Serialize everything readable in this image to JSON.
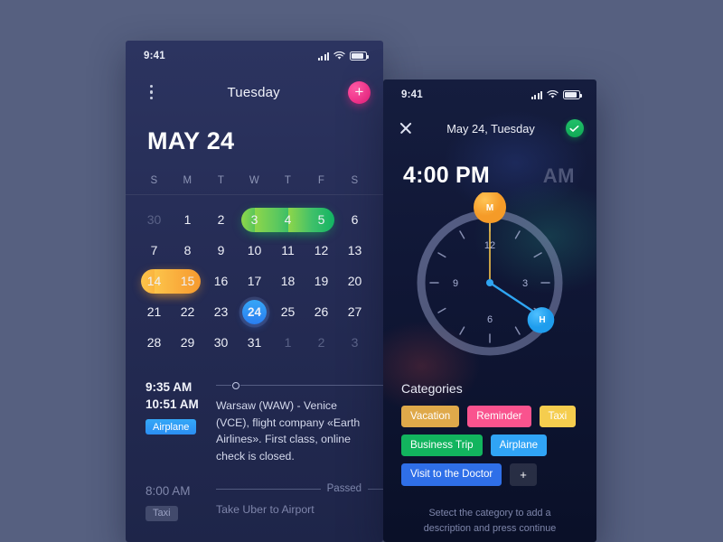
{
  "calendar_phone": {
    "status_bar": {
      "time": "9:41",
      "signal_icon": "signal-bars-icon",
      "wifi_icon": "wifi-icon",
      "battery_icon": "battery-icon"
    },
    "nav": {
      "menu_icon": "more-vertical-icon",
      "title": "Tuesday",
      "add_icon": "plus-icon"
    },
    "month_title": "MAY 24",
    "weekdays": [
      "S",
      "M",
      "T",
      "W",
      "T",
      "F",
      "S"
    ],
    "days": [
      {
        "label": "30",
        "type": "muted"
      },
      {
        "label": "1",
        "type": "normal"
      },
      {
        "label": "2",
        "type": "normal"
      },
      {
        "label": "3",
        "type": "range-green-start"
      },
      {
        "label": "4",
        "type": "range-green-mid"
      },
      {
        "label": "5",
        "type": "range-green-end"
      },
      {
        "label": "6",
        "type": "normal"
      },
      {
        "label": "7",
        "type": "normal"
      },
      {
        "label": "8",
        "type": "normal"
      },
      {
        "label": "9",
        "type": "normal"
      },
      {
        "label": "10",
        "type": "normal"
      },
      {
        "label": "11",
        "type": "normal"
      },
      {
        "label": "12",
        "type": "normal"
      },
      {
        "label": "13",
        "type": "normal"
      },
      {
        "label": "14",
        "type": "range-orange-start"
      },
      {
        "label": "15",
        "type": "range-orange-end"
      },
      {
        "label": "16",
        "type": "normal"
      },
      {
        "label": "17",
        "type": "normal"
      },
      {
        "label": "18",
        "type": "normal"
      },
      {
        "label": "19",
        "type": "normal"
      },
      {
        "label": "20",
        "type": "normal"
      },
      {
        "label": "21",
        "type": "normal"
      },
      {
        "label": "22",
        "type": "normal"
      },
      {
        "label": "23",
        "type": "normal"
      },
      {
        "label": "24",
        "type": "selected"
      },
      {
        "label": "25",
        "type": "normal"
      },
      {
        "label": "26",
        "type": "normal"
      },
      {
        "label": "27",
        "type": "normal"
      },
      {
        "label": "28",
        "type": "normal"
      },
      {
        "label": "29",
        "type": "normal"
      },
      {
        "label": "30",
        "type": "normal"
      },
      {
        "label": "31",
        "type": "normal"
      },
      {
        "label": "1",
        "type": "muted"
      },
      {
        "label": "2",
        "type": "muted"
      },
      {
        "label": "3",
        "type": "muted"
      }
    ],
    "events": [
      {
        "start_time": "9:35 AM",
        "end_time": "10:51 AM",
        "category": "Airplane",
        "description": "Warsaw (WAW) - Venice (VCE), flight company «Earth Airlines». First class, online check is closed.",
        "passed": false,
        "status_label": ""
      },
      {
        "start_time": "8:00 AM",
        "end_time": "",
        "category": "Taxi",
        "description": "Take Uber to Airport",
        "passed": true,
        "status_label": "Passed"
      }
    ]
  },
  "timepicker_phone": {
    "status_bar": {
      "time": "9:41",
      "signal_icon": "signal-bars-icon",
      "wifi_icon": "wifi-icon",
      "battery_icon": "battery-icon"
    },
    "nav": {
      "close_icon": "close-icon",
      "title": "May 24, Tuesday",
      "confirm_icon": "check-icon"
    },
    "selected_time": "4:00 PM",
    "ampm_toggle": "AM",
    "clock": {
      "numerals": [
        "12",
        "3",
        "6",
        "9"
      ],
      "minute_handle_label": "M",
      "hour_handle_label": "H",
      "minute_value": 0,
      "hour_value": 4
    },
    "categories_title": "Categories",
    "categories": [
      {
        "label": "Vacation",
        "color": "#dfa94a"
      },
      {
        "label": "Reminder",
        "color": "#f9538e"
      },
      {
        "label": "Taxi",
        "color": "#f5cd4e"
      },
      {
        "label": "Business Trip",
        "color": "#12b45e"
      },
      {
        "label": "Airplane",
        "color": "#30a4f6"
      },
      {
        "label": "Visit to the Doctor",
        "color": "#2f6fe8"
      }
    ],
    "add_category_label": "+",
    "hint": "Setect the category to add a description and press continue"
  },
  "colors": {
    "page_background": "#566080",
    "calendar_background": "#2a3259",
    "timepicker_background": "#101736",
    "accent_pink": "#f42d88",
    "accent_green": "#12b45e",
    "accent_blue": "#2a7ef0",
    "range_green": "#3fc06a",
    "range_orange": "#f9a93a",
    "handle_minute": "#f9a93a",
    "handle_hour": "#30a4f6"
  }
}
